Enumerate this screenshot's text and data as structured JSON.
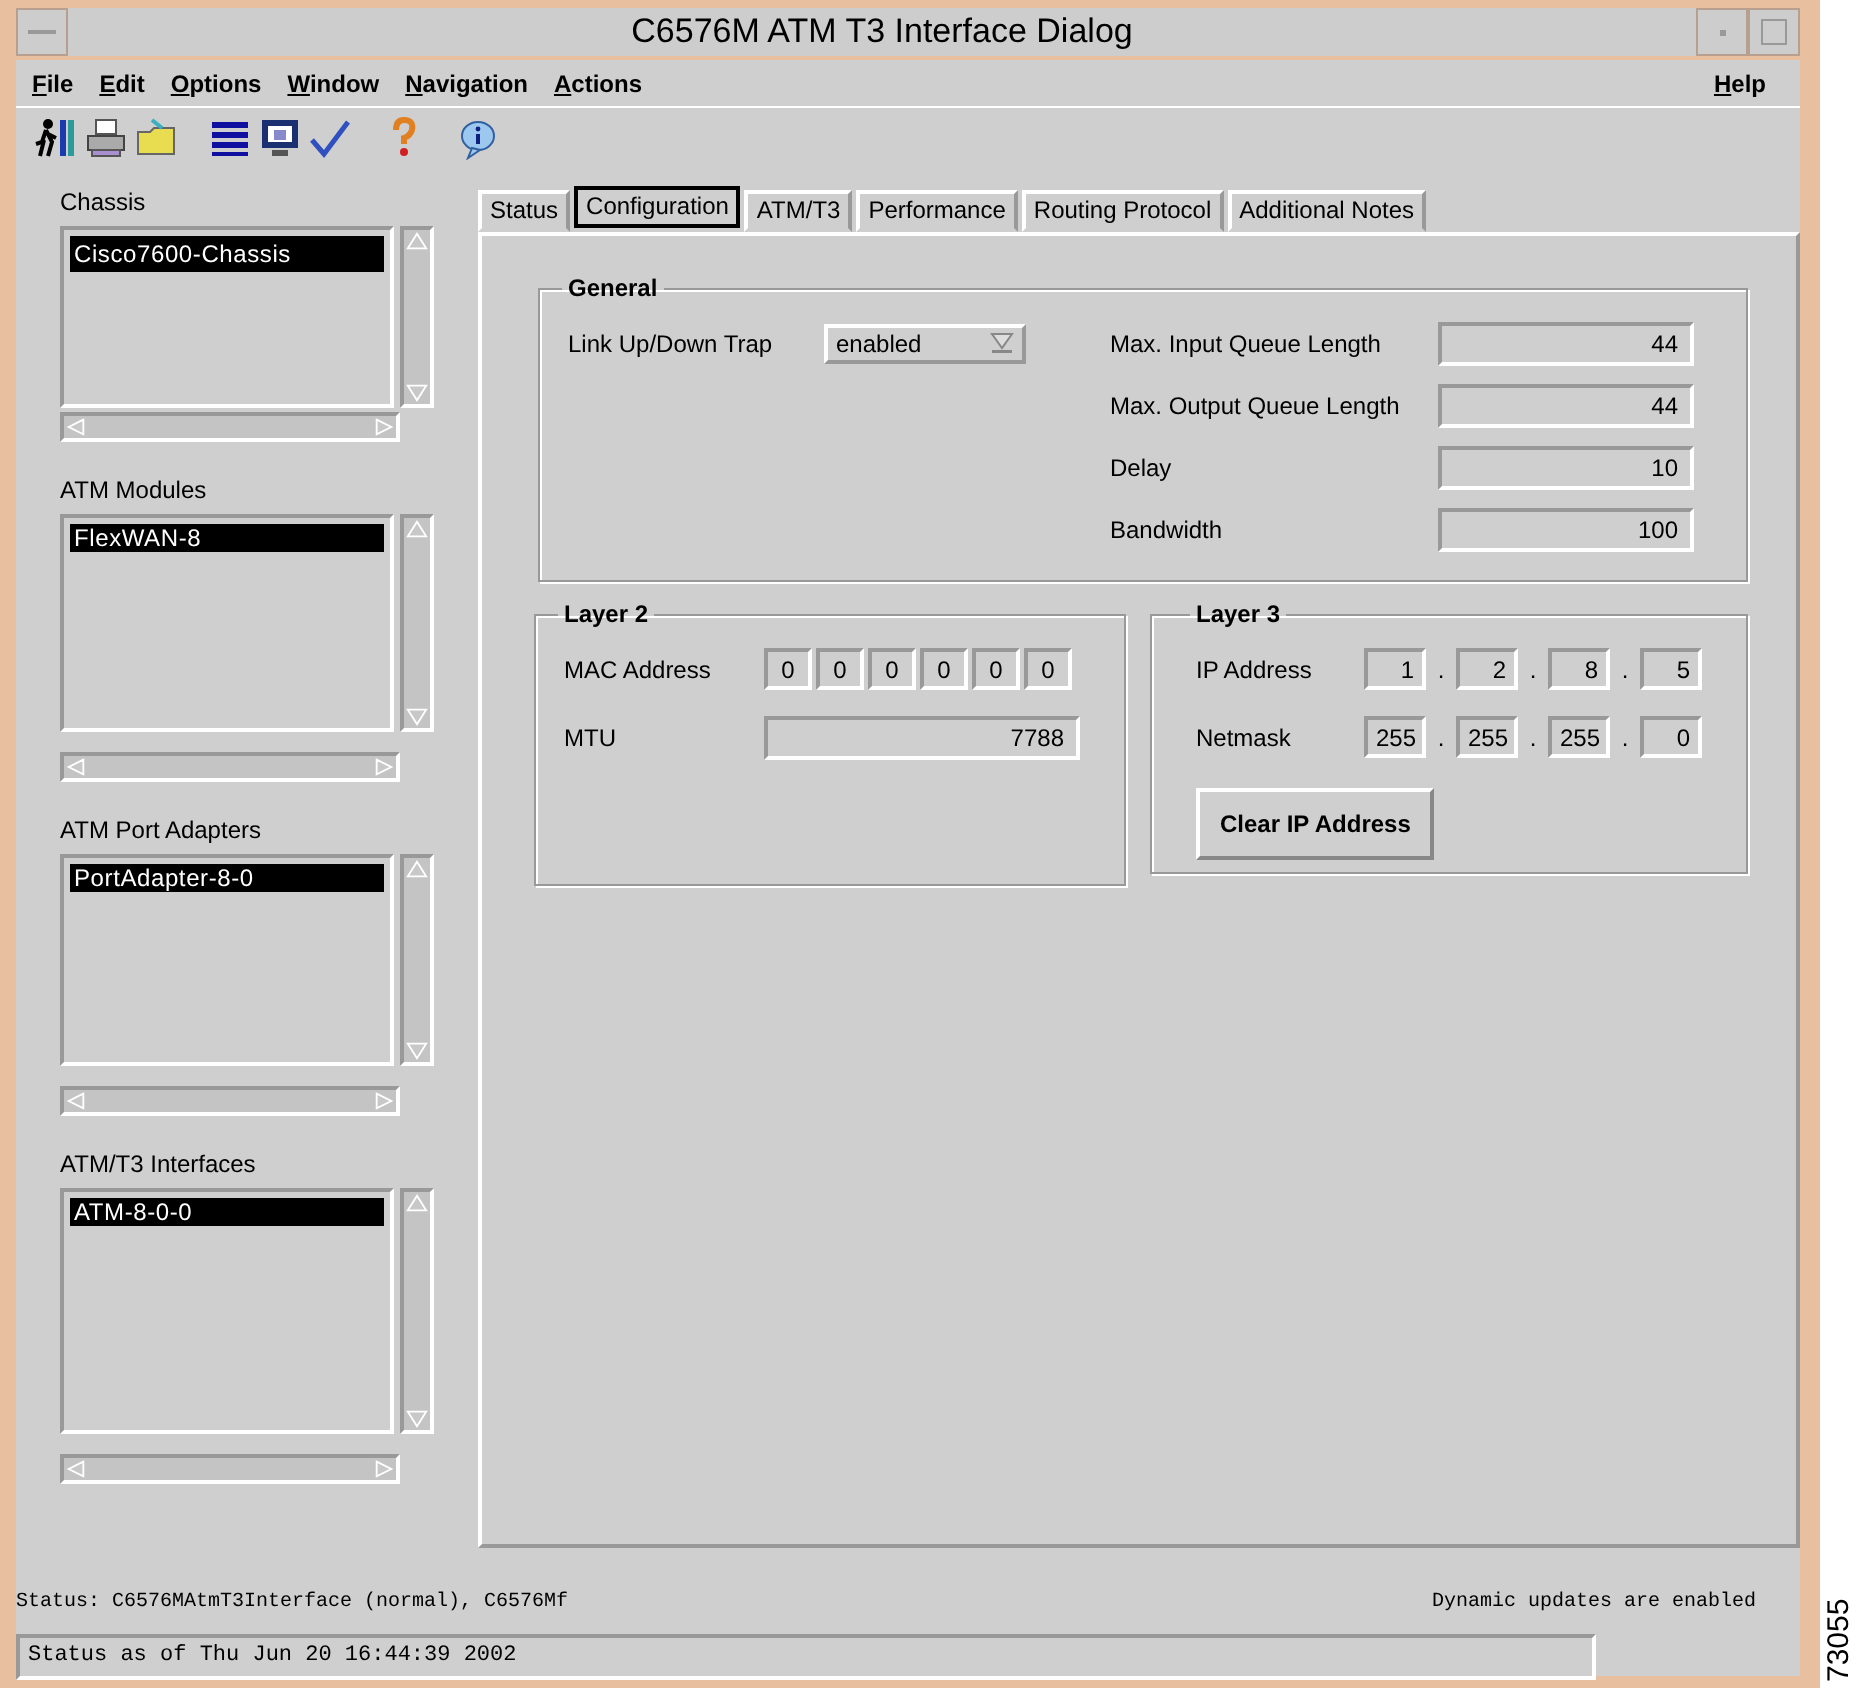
{
  "window": {
    "title": "C6576M ATM T3 Interface Dialog"
  },
  "menu": [
    {
      "label": "File"
    },
    {
      "label": "Edit"
    },
    {
      "label": "Options"
    },
    {
      "label": "Window"
    },
    {
      "label": "Navigation"
    },
    {
      "label": "Actions"
    }
  ],
  "help_menu": {
    "label": "Help"
  },
  "sidebar": {
    "lists": [
      {
        "label": "Chassis",
        "items": [
          {
            "text": "Cisco7600-Chassis",
            "selected": true
          }
        ]
      },
      {
        "label": "ATM Modules",
        "items": [
          {
            "text": "FlexWAN-8",
            "selected": true
          }
        ]
      },
      {
        "label": "ATM Port Adapters",
        "items": [
          {
            "text": "PortAdapter-8-0",
            "selected": true
          }
        ]
      },
      {
        "label": "ATM/T3 Interfaces",
        "items": [
          {
            "text": "ATM-8-0-0",
            "selected": true
          }
        ]
      }
    ]
  },
  "tabs": [
    {
      "label": "Status",
      "selected": false
    },
    {
      "label": "Configuration",
      "selected": true
    },
    {
      "label": "ATM/T3",
      "selected": false
    },
    {
      "label": "Performance",
      "selected": false
    },
    {
      "label": "Routing Protocol",
      "selected": false
    },
    {
      "label": "Additional Notes",
      "selected": false
    }
  ],
  "general": {
    "title": "General",
    "link_trap": {
      "label": "Link Up/Down Trap",
      "value": "enabled"
    },
    "fields": [
      {
        "label": "Max. Input Queue Length",
        "value": "44"
      },
      {
        "label": "Max. Output Queue Length",
        "value": "44"
      },
      {
        "label": "Delay",
        "value": "10"
      },
      {
        "label": "Bandwidth",
        "value": "100"
      }
    ]
  },
  "layer2": {
    "title": "Layer 2",
    "mac": {
      "label": "MAC Address",
      "octets": [
        "0",
        "0",
        "0",
        "0",
        "0",
        "0"
      ]
    },
    "mtu": {
      "label": "MTU",
      "value": "7788"
    }
  },
  "layer3": {
    "title": "Layer 3",
    "separator": ".",
    "ip": {
      "label": "IP Address",
      "octets": [
        "1",
        "2",
        "8",
        "5"
      ]
    },
    "netmask": {
      "label": "Netmask",
      "octets": [
        "255",
        "255",
        "255",
        "0"
      ]
    },
    "button": "Clear IP Address"
  },
  "status_bar": {
    "status": "Status: C6576MAtmT3Interface (normal), C6576Mf",
    "updates": "Dynamic updates are enabled",
    "status_as_of": "Status as of Thu Jun 20 16:44:39 2002"
  },
  "figure_number": "73055"
}
